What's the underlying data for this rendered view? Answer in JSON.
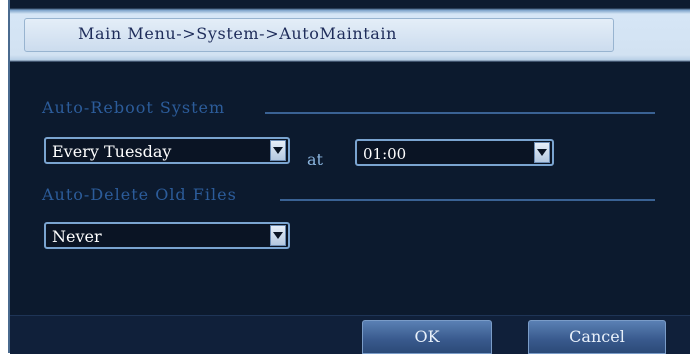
{
  "window": {
    "title": "Main Menu->System->AutoMaintain"
  },
  "auto_reboot": {
    "section_label": "Auto-Reboot System",
    "day_value": "Every Tuesday",
    "at_label": "at",
    "time_value": "01:00"
  },
  "auto_delete": {
    "section_label": "Auto-Delete Old Files",
    "value": "Never"
  },
  "buttons": {
    "ok": "OK",
    "cancel": "Cancel"
  },
  "colors": {
    "background": "#0c1a2e",
    "section_label": "#2c5c9a",
    "title_text": "#1e2c5a",
    "field_border": "#7aa4d0"
  }
}
